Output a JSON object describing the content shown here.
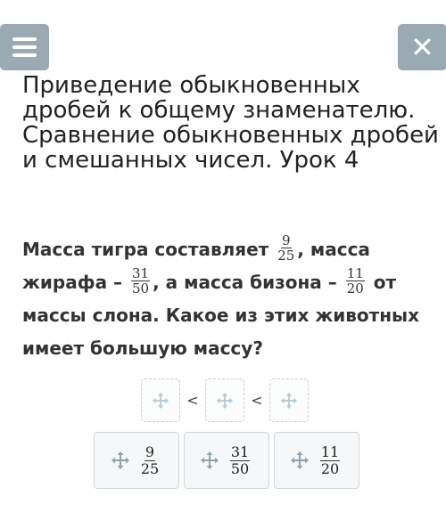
{
  "header": {
    "menu_icon": "hamburger-menu-icon",
    "close_icon": "close-icon",
    "title": "Приведение обыкновенных дробей к общему знаменателю. Сравнение обыкновенных дробей и смешанных чисел. Урок 4"
  },
  "question": {
    "part1": "Масса тигра составляет",
    "frac1": {
      "num": "9",
      "den": "25"
    },
    "part2": ", масса жирафа –",
    "frac2": {
      "num": "31",
      "den": "50"
    },
    "part3": ", а масса бизона –",
    "frac3": {
      "num": "11",
      "den": "20"
    },
    "part4": "от массы слона. Какое из этих животных имеет большую массу?"
  },
  "answer": {
    "separator_1": "<",
    "separator_2": "<",
    "slot_icon": "move-icon"
  },
  "chips": [
    {
      "num": "9",
      "den": "25",
      "icon": "move-icon"
    },
    {
      "num": "31",
      "den": "50",
      "icon": "move-icon"
    },
    {
      "num": "11",
      "den": "20",
      "icon": "move-icon"
    }
  ],
  "colors": {
    "top_button": "#9aaab3",
    "move_icon_slot": "#b8c8cf",
    "move_icon_chip": "#8fa3ad"
  }
}
